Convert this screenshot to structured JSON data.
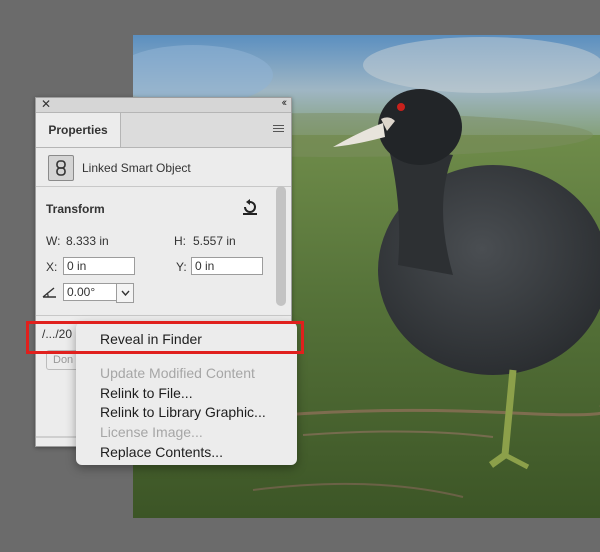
{
  "panel": {
    "tab_label": "Properties",
    "smart_object_label": "Linked Smart Object",
    "transform": {
      "title": "Transform",
      "w_label": "W:",
      "w_value": "8.333 in",
      "h_label": "H:",
      "h_value": "5.557 in",
      "x_label": "X:",
      "x_value": "0 in",
      "y_label": "Y:",
      "y_value": "0 in",
      "angle_value": "0.00°"
    },
    "path_text": "/.../20",
    "done_label": "Don"
  },
  "context_menu": {
    "items": [
      {
        "label": "Reveal in Finder",
        "enabled": true,
        "highlighted": true
      },
      {
        "label": "Update Modified Content",
        "enabled": false
      },
      {
        "label": "Relink to File...",
        "enabled": true
      },
      {
        "label": "Relink to Library Graphic...",
        "enabled": true
      },
      {
        "label": "License Image...",
        "enabled": false
      },
      {
        "label": "Replace Contents...",
        "enabled": true
      }
    ]
  },
  "colors": {
    "highlight_outline": "#e0201d",
    "canvas_background": "#6b6b6b",
    "panel_background": "#ececec"
  },
  "icons": {
    "close": "close-icon",
    "collapse": "collapse-icon",
    "panel_menu": "menu-icon",
    "smart_object": "linked-smart-object-icon",
    "reset": "reset-transform-icon",
    "angle": "angle-icon",
    "dropdown": "chevron-down-icon"
  }
}
